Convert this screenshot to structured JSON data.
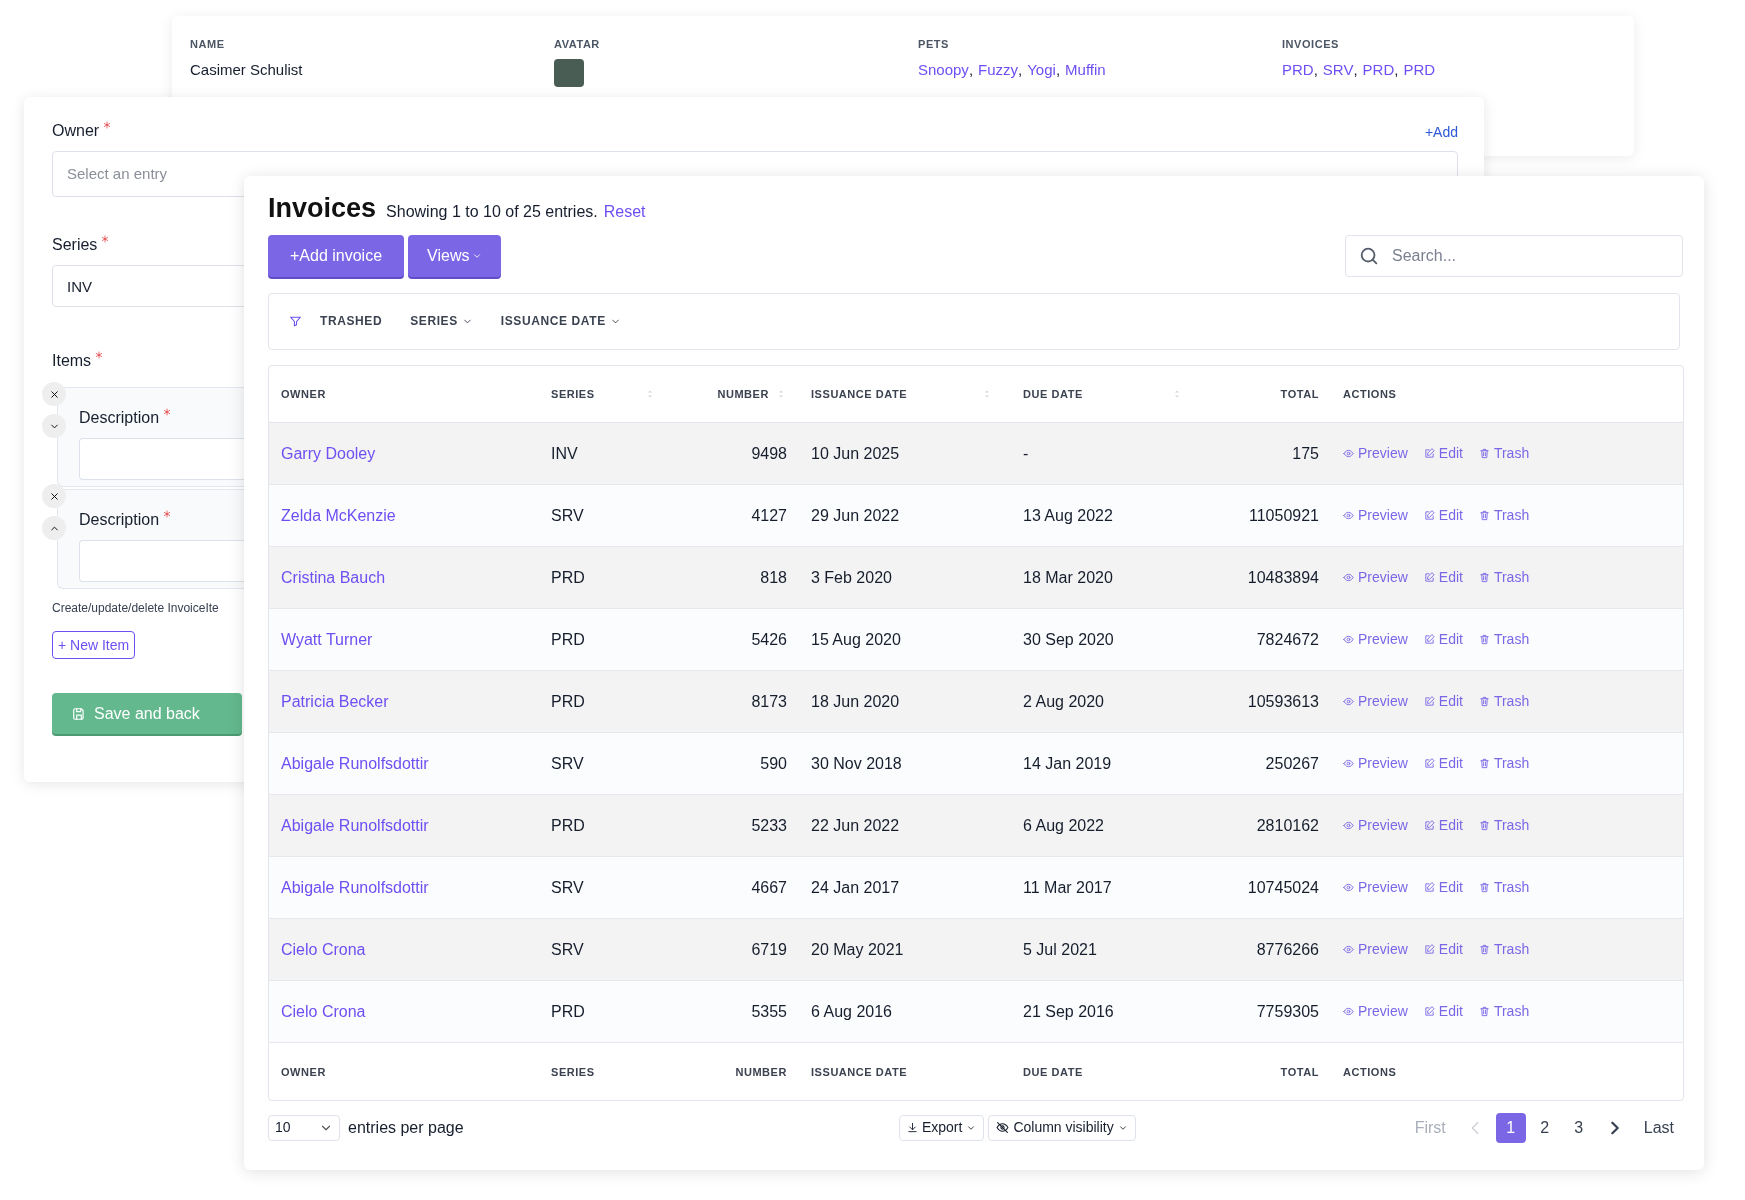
{
  "record_card": {
    "columns": [
      {
        "label": "NAME",
        "kind": "text",
        "value": "Casimer Schulist"
      },
      {
        "label": "AVATAR",
        "kind": "avatar"
      },
      {
        "label": "PETS",
        "kind": "links",
        "links": [
          {
            "text": "Snoopy",
            "separator": ","
          },
          {
            "text": "Fuzzy",
            "separator": ","
          },
          {
            "text": "Yogi",
            "separator": ","
          },
          {
            "text": "Muffin"
          }
        ]
      },
      {
        "label": "INVOICES",
        "kind": "links",
        "links": [
          {
            "text": "PRD",
            "separator": ","
          },
          {
            "text": "SRV",
            "separator": ","
          },
          {
            "text": "PRD",
            "separator": ","
          },
          {
            "text": "PRD"
          }
        ]
      }
    ]
  },
  "form": {
    "owner": {
      "label": "Owner",
      "required": true,
      "placeholder": "Select an entry",
      "add_link": "+Add"
    },
    "series": {
      "label": "Series",
      "required": true,
      "value": "INV"
    },
    "items": {
      "label": "Items",
      "required": true,
      "entries": [
        {
          "label": "Description",
          "required": true,
          "kind": "move_down"
        },
        {
          "label": "Description",
          "required": true,
          "kind": "move_up"
        }
      ]
    },
    "help_text": "Create/update/delete InvoiceIte",
    "new_item_button": "+ New Item",
    "save_button": "Save and back"
  },
  "invoices": {
    "title": "Invoices",
    "summary": "Showing 1 to 10 of 25 entries.",
    "reset_link": "Reset",
    "add_button": "+Add invoice",
    "views_button": "Views",
    "search": {
      "placeholder": "Search..."
    },
    "filters": [
      {
        "label": "TRASHED",
        "kind": "toggle"
      },
      {
        "label": "SERIES",
        "kind": "dropdown"
      },
      {
        "label": "ISSUANCE DATE",
        "kind": "dropdown"
      }
    ],
    "columns": [
      {
        "label": "OWNER",
        "sortable": false,
        "kind": "text"
      },
      {
        "label": "SERIES",
        "sortable": true,
        "kind": "text"
      },
      {
        "label": "NUMBER",
        "sortable": true,
        "kind": "numeric"
      },
      {
        "label": "ISSUANCE DATE",
        "sortable": true,
        "kind": "text"
      },
      {
        "label": "DUE DATE",
        "sortable": true,
        "kind": "text"
      },
      {
        "label": "TOTAL",
        "sortable": false,
        "kind": "numeric"
      },
      {
        "label": "ACTIONS",
        "sortable": false,
        "kind": "text"
      }
    ],
    "rows": [
      {
        "owner": "Garry Dooley",
        "series": "INV",
        "number": "9498",
        "issuance_date": "10 Jun 2025",
        "due_date": "-",
        "total": "175",
        "actions": [
          "Preview",
          "Edit",
          "Trash"
        ]
      },
      {
        "owner": "Zelda McKenzie",
        "series": "SRV",
        "number": "4127",
        "issuance_date": "29 Jun 2022",
        "due_date": "13 Aug 2022",
        "total": "11050921",
        "actions": [
          "Preview",
          "Edit",
          "Trash"
        ]
      },
      {
        "owner": "Cristina Bauch",
        "series": "PRD",
        "number": "818",
        "issuance_date": "3 Feb 2020",
        "due_date": "18 Mar 2020",
        "total": "10483894",
        "actions": [
          "Preview",
          "Edit",
          "Trash"
        ]
      },
      {
        "owner": "Wyatt Turner",
        "series": "PRD",
        "number": "5426",
        "issuance_date": "15 Aug 2020",
        "due_date": "30 Sep 2020",
        "total": "7824672",
        "actions": [
          "Preview",
          "Edit",
          "Trash"
        ]
      },
      {
        "owner": "Patricia Becker",
        "series": "PRD",
        "number": "8173",
        "issuance_date": "18 Jun 2020",
        "due_date": "2 Aug 2020",
        "total": "10593613",
        "actions": [
          "Preview",
          "Edit",
          "Trash"
        ]
      },
      {
        "owner": "Abigale Runolfsdottir",
        "series": "SRV",
        "number": "590",
        "issuance_date": "30 Nov 2018",
        "due_date": "14 Jan 2019",
        "total": "250267",
        "actions": [
          "Preview",
          "Edit",
          "Trash"
        ]
      },
      {
        "owner": "Abigale Runolfsdottir",
        "series": "PRD",
        "number": "5233",
        "issuance_date": "22 Jun 2022",
        "due_date": "6 Aug 2022",
        "total": "2810162",
        "actions": [
          "Preview",
          "Edit",
          "Trash"
        ]
      },
      {
        "owner": "Abigale Runolfsdottir",
        "series": "SRV",
        "number": "4667",
        "issuance_date": "24 Jan 2017",
        "due_date": "11 Mar 2017",
        "total": "10745024",
        "actions": [
          "Preview",
          "Edit",
          "Trash"
        ]
      },
      {
        "owner": "Cielo Crona",
        "series": "SRV",
        "number": "6719",
        "issuance_date": "20 May 2021",
        "due_date": "5 Jul 2021",
        "total": "8776266",
        "actions": [
          "Preview",
          "Edit",
          "Trash"
        ]
      },
      {
        "owner": "Cielo Crona",
        "series": "PRD",
        "number": "5355",
        "issuance_date": "6 Aug 2016",
        "due_date": "21 Sep 2016",
        "total": "7759305",
        "actions": [
          "Preview",
          "Edit",
          "Trash"
        ]
      }
    ],
    "footer_columns": [
      "OWNER",
      "SERIES",
      "NUMBER",
      "ISSUANCE DATE",
      "DUE DATE",
      "TOTAL",
      "ACTIONS"
    ],
    "per_page": {
      "value": "10",
      "label": "entries per page"
    },
    "export_button": "Export",
    "column_visibility_button": "Column visibility",
    "pagination": [
      {
        "label": "First",
        "kind": "text",
        "selected": false,
        "disabled": true
      },
      {
        "kind": "prev",
        "selected": false,
        "disabled": true
      },
      {
        "label": "1",
        "kind": "text",
        "selected": true,
        "disabled": false
      },
      {
        "label": "2",
        "kind": "text",
        "selected": false,
        "disabled": false
      },
      {
        "label": "3",
        "kind": "text",
        "selected": false,
        "disabled": false
      },
      {
        "kind": "next",
        "selected": false,
        "disabled": false
      },
      {
        "label": "Last",
        "kind": "text",
        "selected": false,
        "disabled": false
      }
    ]
  }
}
